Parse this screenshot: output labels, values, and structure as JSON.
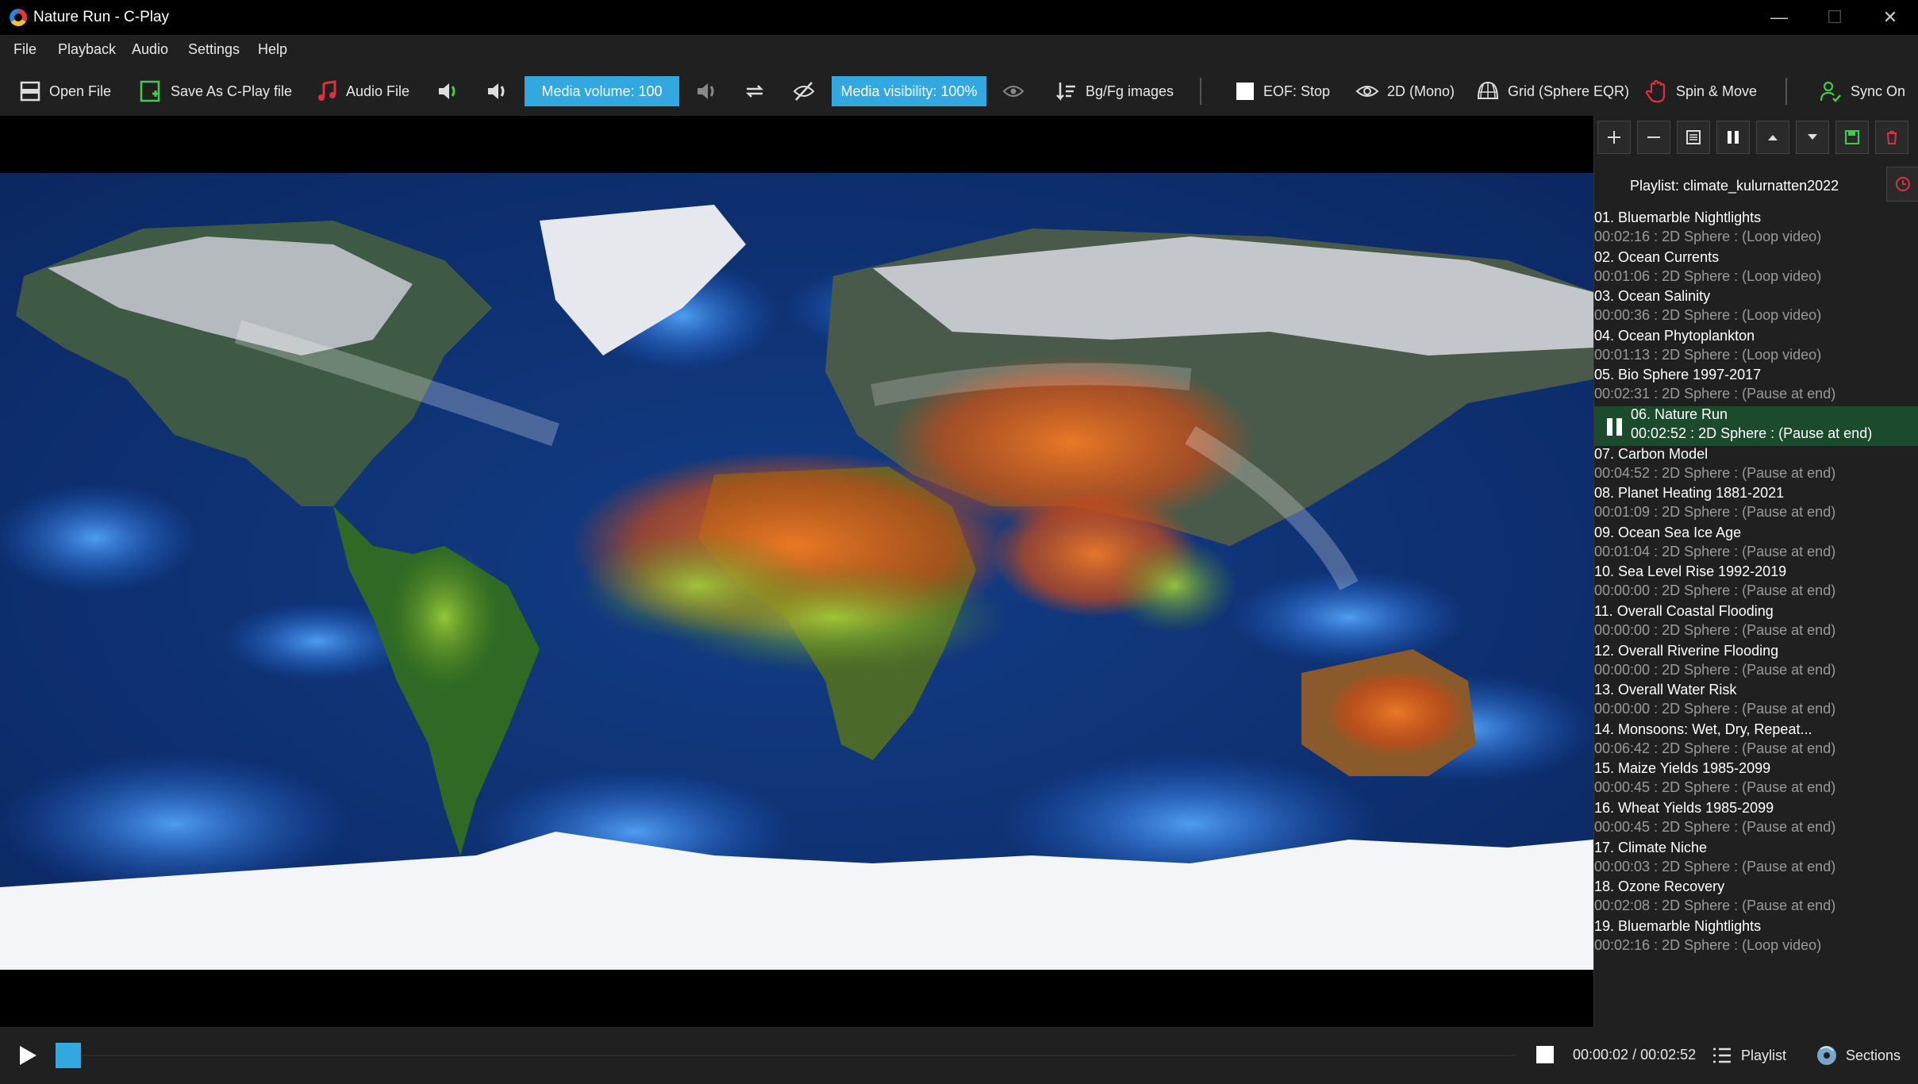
{
  "window": {
    "title": "Nature Run - C-Play"
  },
  "menu": [
    "File",
    "Playback",
    "Audio",
    "Settings",
    "Help"
  ],
  "toolbar": {
    "open_file": "Open File",
    "save_as": "Save As C-Play file",
    "audio_file": "Audio File",
    "media_volume": "Media volume: 100",
    "media_visibility": "Media visibility: 100%",
    "bg_fg_images": "Bg/Fg images",
    "eof": "EOF: Stop",
    "view_mode": "2D (Mono)",
    "grid": "Grid (Sphere EQR)",
    "spin_move": "Spin & Move",
    "sync": "Sync On"
  },
  "playlist": {
    "title": "Playlist: climate_kulurnatten2022",
    "items": [
      {
        "title": "01. Bluemarble Nightlights",
        "meta": "00:02:16 : 2D Sphere : (Loop video)"
      },
      {
        "title": "02. Ocean Currents",
        "meta": "00:01:06 : 2D Sphere : (Loop video)"
      },
      {
        "title": "03. Ocean Salinity",
        "meta": "00:00:36 : 2D Sphere : (Loop video)"
      },
      {
        "title": "04. Ocean Phytoplankton",
        "meta": "00:01:13 : 2D Sphere : (Loop video)"
      },
      {
        "title": "05. Bio Sphere 1997-2017",
        "meta": "00:02:31 : 2D Sphere : (Pause at end)"
      },
      {
        "title": "06. Nature Run",
        "meta": "00:02:52 : 2D Sphere : (Pause at end)",
        "active": true
      },
      {
        "title": "07. Carbon Model",
        "meta": "00:04:52 : 2D Sphere : (Pause at end)"
      },
      {
        "title": "08. Planet Heating 1881-2021",
        "meta": "00:01:09 : 2D Sphere : (Pause at end)"
      },
      {
        "title": "09. Ocean Sea Ice Age",
        "meta": "00:01:04 : 2D Sphere : (Pause at end)"
      },
      {
        "title": "10. Sea Level Rise 1992-2019",
        "meta": "00:00:00 : 2D Sphere : (Pause at end)"
      },
      {
        "title": "11. Overall Coastal Flooding",
        "meta": "00:00:00 : 2D Sphere : (Pause at end)"
      },
      {
        "title": "12. Overall Riverine Flooding",
        "meta": "00:00:00 : 2D Sphere : (Pause at end)"
      },
      {
        "title": "13. Overall Water Risk",
        "meta": "00:00:00 : 2D Sphere : (Pause at end)"
      },
      {
        "title": "14. Monsoons: Wet, Dry, Repeat...",
        "meta": "00:06:42 : 2D Sphere : (Pause at end)"
      },
      {
        "title": "15. Maize Yields 1985-2099",
        "meta": "00:00:45 : 2D Sphere : (Pause at end)"
      },
      {
        "title": "16. Wheat Yields 1985-2099",
        "meta": "00:00:45 : 2D Sphere : (Pause at end)"
      },
      {
        "title": "17. Climate Niche",
        "meta": "00:00:03 : 2D Sphere : (Pause at end)"
      },
      {
        "title": "18. Ozone Recovery",
        "meta": "00:02:08 : 2D Sphere : (Pause at end)"
      },
      {
        "title": "19. Bluemarble Nightlights",
        "meta": "00:02:16 : 2D Sphere : (Loop video)"
      }
    ]
  },
  "bottom": {
    "time": "00:00:02 / 00:02:52",
    "playlist": "Playlist",
    "sections": "Sections"
  },
  "colors": {
    "accent": "#33a7e0",
    "active_row": "#1c4a2c",
    "background": "#202020"
  }
}
